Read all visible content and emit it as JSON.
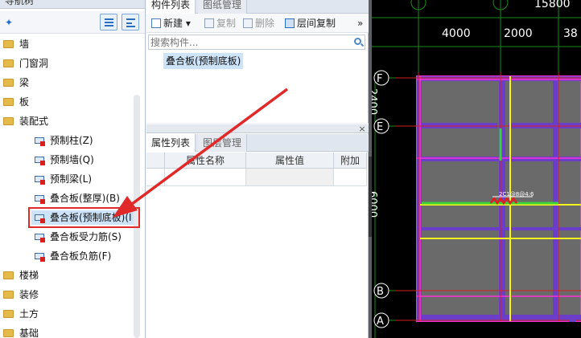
{
  "nav": {
    "title": "导航树",
    "items": [
      {
        "label": "墙",
        "type": "folder"
      },
      {
        "label": "门窗洞",
        "type": "folder"
      },
      {
        "label": "梁",
        "type": "folder"
      },
      {
        "label": "板",
        "type": "folder"
      },
      {
        "label": "装配式",
        "type": "folder"
      },
      {
        "label": "预制柱(Z)",
        "type": "child"
      },
      {
        "label": "预制墙(Q)",
        "type": "child"
      },
      {
        "label": "预制梁(L)",
        "type": "child"
      },
      {
        "label": "叠合板(整厚)(B)",
        "type": "child"
      },
      {
        "label": "叠合板(预制底板)(I",
        "type": "child",
        "selected": true
      },
      {
        "label": "叠合板受力筋(S)",
        "type": "child"
      },
      {
        "label": "叠合板负筋(F)",
        "type": "child"
      },
      {
        "label": "楼梯",
        "type": "folder"
      },
      {
        "label": "装修",
        "type": "folder"
      },
      {
        "label": "土方",
        "type": "folder"
      },
      {
        "label": "基础",
        "type": "folder"
      }
    ]
  },
  "component_panel": {
    "tab_active": "构件列表",
    "tab_inactive": "图纸管理",
    "toolbar": {
      "new": "新建",
      "copy": "复制",
      "delete": "删除",
      "layer_copy": "层间复制",
      "more": "»"
    },
    "search_placeholder": "搜索构件...",
    "items": [
      "叠合板(预制底板)"
    ]
  },
  "property_panel": {
    "tab_active": "属性列表",
    "tab_inactive": "图层管理",
    "close": "×",
    "columns": [
      "属性名称",
      "属性值",
      "附加"
    ]
  },
  "canvas": {
    "top_dimension": "15800",
    "dimensions": [
      "4000",
      "2000",
      "38"
    ],
    "axes": [
      "F",
      "E",
      "B",
      "A"
    ],
    "left_dimension_1": "2400",
    "left_dimension_2": "6000",
    "rebar_label": "2C1@8@4:6",
    "colors": {
      "background": "#000000",
      "slab": "#6a6a6a",
      "beam": "#6a3ec8",
      "wall_magenta": "#ff2fd6",
      "axis_line": "#d62020",
      "grid": "#1d8a1d",
      "rebar_yellow": "#f5f51a",
      "rebar_green": "#3cd23c"
    }
  },
  "annotation": {
    "highlight_color": "#e02a2a"
  }
}
